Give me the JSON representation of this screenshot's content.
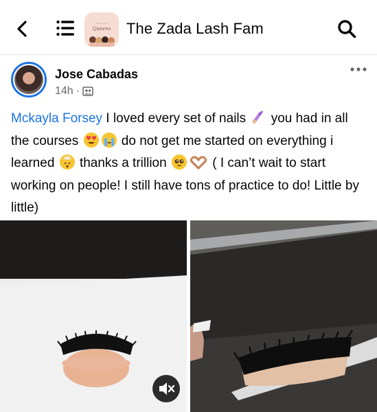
{
  "header": {
    "back_icon": "back-chevron-icon",
    "menu_icon": "hamburger-menu-icon",
    "group_avatar_text_top": "ZADA LASH",
    "group_avatar_text_script": "Queens",
    "group_title": "The Zada Lash Fam",
    "search_icon": "search-icon"
  },
  "post": {
    "author": "Jose Cabadas",
    "time": "14h",
    "separator": "·",
    "audience_icon": "group-members-icon",
    "more_icon": "more-horizontal-icon",
    "mention": "Mckayla Forsey",
    "text_1": " I loved every set of nails ",
    "text_2": " you had in all the courses ",
    "text_3": " do not get me started on everything i learned ",
    "text_4": " thanks a trillion ",
    "text_5": " ( I can’t wait to start working on people! I still have tons of practice to do! Little by little)"
  },
  "media": {
    "mute_icon": "sound-muted-icon"
  },
  "colors": {
    "accent": "#1b74e4",
    "text": "#050505",
    "secondary": "#65676b",
    "divider": "#e4e6eb"
  }
}
